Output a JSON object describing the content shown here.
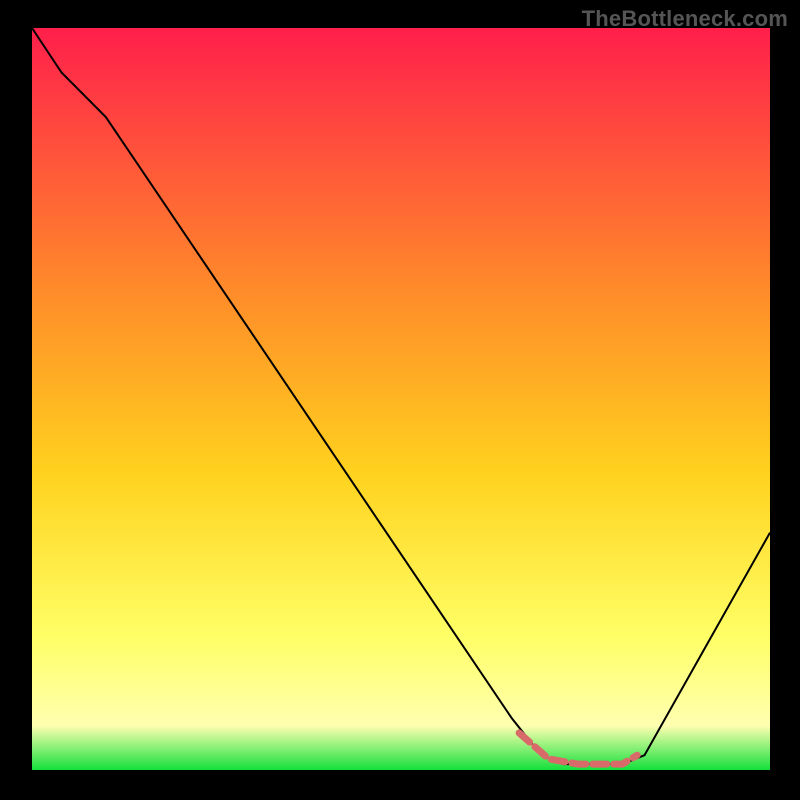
{
  "watermark": "TheBottleneck.com",
  "chart_data": {
    "type": "line",
    "title": "",
    "xlabel": "",
    "ylabel": "",
    "xlim": [
      0,
      100
    ],
    "ylim": [
      0,
      100
    ],
    "curve": [
      {
        "x": 0,
        "y": 100
      },
      {
        "x": 4,
        "y": 94
      },
      {
        "x": 10,
        "y": 88
      },
      {
        "x": 65,
        "y": 7
      },
      {
        "x": 69,
        "y": 2
      },
      {
        "x": 72,
        "y": 0.8
      },
      {
        "x": 80,
        "y": 0.8
      },
      {
        "x": 83,
        "y": 2
      },
      {
        "x": 100,
        "y": 32
      }
    ],
    "optimal_segment": [
      {
        "x": 66,
        "y": 5
      },
      {
        "x": 70,
        "y": 1.5
      },
      {
        "x": 74,
        "y": 0.8
      },
      {
        "x": 80,
        "y": 0.8
      },
      {
        "x": 82,
        "y": 2
      }
    ],
    "background_gradient": {
      "top": "#ff1f4b",
      "mid1": "#ff8a2a",
      "mid2": "#ffd21e",
      "mid3": "#ffff66",
      "band": "#ffffb0",
      "bottom": "#14e03c"
    },
    "curve_color": "#000000",
    "optimal_color": "#d86a6a"
  }
}
